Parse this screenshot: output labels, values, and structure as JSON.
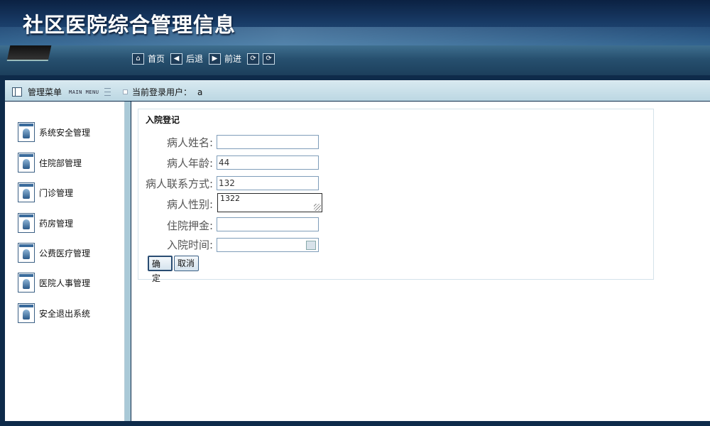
{
  "header": {
    "title": "社区医院综合管理信息"
  },
  "nav": {
    "items": [
      {
        "icon": "home-icon",
        "glyph": "⌂",
        "label": "首页"
      },
      {
        "icon": "back-arrow-icon",
        "glyph": "◀",
        "label": "后退"
      },
      {
        "icon": "forward-arrow-icon",
        "glyph": "▶",
        "label": "前进"
      },
      {
        "icon": "refresh-icon",
        "glyph": "⟳",
        "label": ""
      }
    ]
  },
  "menubar": {
    "title": "管理菜单",
    "subtitle": "MAIN MENU",
    "user_label": "当前登录用户：",
    "user_name": "a"
  },
  "sidebar": {
    "items": [
      {
        "label": "系统安全管理"
      },
      {
        "label": "住院部管理"
      },
      {
        "label": "门诊管理"
      },
      {
        "label": "药房管理"
      },
      {
        "label": "公费医疗管理"
      },
      {
        "label": "医院人事管理"
      },
      {
        "label": "安全退出系统"
      }
    ]
  },
  "form": {
    "title": "入院登记",
    "fields": {
      "name": {
        "label": "病人姓名:",
        "value": ""
      },
      "age": {
        "label": "病人年龄:",
        "value": "44"
      },
      "contact": {
        "label": "病人联系方式:",
        "value": "132"
      },
      "gender": {
        "label": "病人性别:",
        "value": "1322"
      },
      "deposit": {
        "label": "住院押金:",
        "value": ""
      },
      "admit_time": {
        "label": "入院时间:",
        "value": ""
      }
    },
    "buttons": {
      "ok": "确定",
      "cancel": "取消"
    }
  }
}
